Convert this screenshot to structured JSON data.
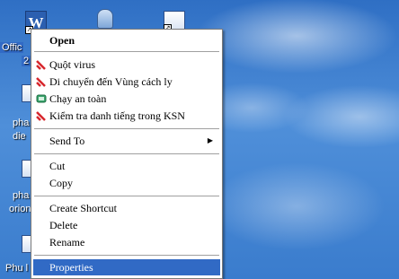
{
  "desktop": {
    "icons": [
      {
        "label": "Offic"
      },
      {
        "label": "2"
      },
      {
        "label": "pha"
      },
      {
        "label": "die"
      },
      {
        "label": "pha"
      },
      {
        "label": "orion"
      },
      {
        "label": "Phu l"
      }
    ]
  },
  "menu": {
    "open": "Open",
    "scan": "Quột virus",
    "move": "Di chuyển đến Vùng cách ly",
    "safe_run": "Chạy an toàn",
    "reputation": "Kiểm tra danh tiếng trong KSN",
    "send_to": "Send To",
    "cut": "Cut",
    "copy": "Copy",
    "create_shortcut": "Create Shortcut",
    "delete": "Delete",
    "rename": "Rename",
    "properties": "Properties"
  },
  "colors": {
    "highlight": "#316ac5",
    "kaspersky_red": "#d7262c",
    "desktop_blue": "#3d7fd0"
  }
}
